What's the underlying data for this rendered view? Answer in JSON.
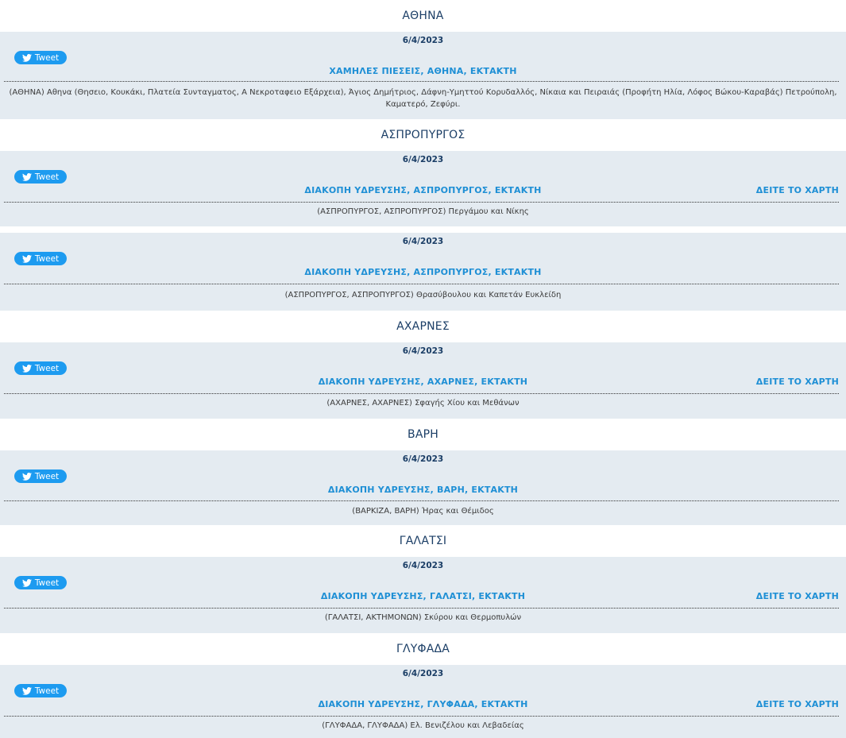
{
  "tweet_label": "Tweet",
  "map_label": "ΔΕΙΤΕ ΤΟ ΧΑΡΤΗ",
  "colors": {
    "header_text": "#1b3e66",
    "card_background": "#e4ebf1",
    "link": "#1e8fd5",
    "tweet_button": "#1d9bf0"
  },
  "areas": [
    {
      "name": "ΑΘΗΝΑ",
      "notices": [
        {
          "date": "6/4/2023",
          "title": "ΧΑΜΗΛΕΣ ΠΙΕΣΕΙΣ, ΑΘΗΝΑ, ΕΚΤΑΚΤΗ",
          "has_map": false,
          "detail": "(ΑΘΗΝΑ) Αθηνα (Θησειο, Κουκάκι, Πλατεία Συνταγματος, Α Νεκροταφειο Εξάρχεια), Άγιος Δημήτριος, Δάφνη-Υμηττού Κορυδαλλός, Νίκαια και Πειραιάς (Προφήτη Ηλία, Λόφος Βώκου-Καραβάς) Πετρούπολη, Καματερό, Ζεφύρι."
        }
      ]
    },
    {
      "name": "ΑΣΠΡΟΠΥΡΓΟΣ",
      "notices": [
        {
          "date": "6/4/2023",
          "title": "ΔΙΑΚΟΠΗ ΥΔΡΕΥΣΗΣ, ΑΣΠΡΟΠΥΡΓΟΣ, ΕΚΤΑΚΤΗ",
          "has_map": true,
          "detail": "(ΑΣΠΡΟΠΥΡΓΟΣ, ΑΣΠΡΟΠΥΡΓΟΣ) Περγάμου και Νίκης"
        },
        {
          "date": "6/4/2023",
          "title": "ΔΙΑΚΟΠΗ ΥΔΡΕΥΣΗΣ, ΑΣΠΡΟΠΥΡΓΟΣ, ΕΚΤΑΚΤΗ",
          "has_map": false,
          "detail": "(ΑΣΠΡΟΠΥΡΓΟΣ, ΑΣΠΡΟΠΥΡΓΟΣ) Θρασύβουλου και Καπετάν Ευκλείδη"
        }
      ]
    },
    {
      "name": "ΑΧΑΡΝΕΣ",
      "notices": [
        {
          "date": "6/4/2023",
          "title": "ΔΙΑΚΟΠΗ ΥΔΡΕΥΣΗΣ, ΑΧΑΡΝΕΣ, ΕΚΤΑΚΤΗ",
          "has_map": true,
          "detail": "(ΑΧΑΡΝΕΣ, ΑΧΑΡΝΕΣ) Σφαγής Χίου και Μεθάνων"
        }
      ]
    },
    {
      "name": "ΒΑΡΗ",
      "notices": [
        {
          "date": "6/4/2023",
          "title": "ΔΙΑΚΟΠΗ ΥΔΡΕΥΣΗΣ, ΒΑΡΗ, ΕΚΤΑΚΤΗ",
          "has_map": false,
          "detail": "(ΒΑΡΚΙΖΑ, ΒΑΡΗ) Ήρας και Θέμιδος"
        }
      ]
    },
    {
      "name": "ΓΑΛΑΤΣΙ",
      "notices": [
        {
          "date": "6/4/2023",
          "title": "ΔΙΑΚΟΠΗ ΥΔΡΕΥΣΗΣ, ΓΑΛΑΤΣΙ, ΕΚΤΑΚΤΗ",
          "has_map": true,
          "detail": "(ΓΑΛΑΤΣΙ, ΑΚΤΗΜΟΝΩΝ) Σκύρου και Θερμοπυλών"
        }
      ]
    },
    {
      "name": "ΓΛΥΦΑΔΑ",
      "notices": [
        {
          "date": "6/4/2023",
          "title": "ΔΙΑΚΟΠΗ ΥΔΡΕΥΣΗΣ, ΓΛΥΦΑΔΑ, ΕΚΤΑΚΤΗ",
          "has_map": true,
          "detail": "(ΓΛΥΦΑΔΑ, ΓΛΥΦΑΔΑ) Ελ. Βενιζέλου και Λεβαδείας"
        }
      ]
    }
  ]
}
